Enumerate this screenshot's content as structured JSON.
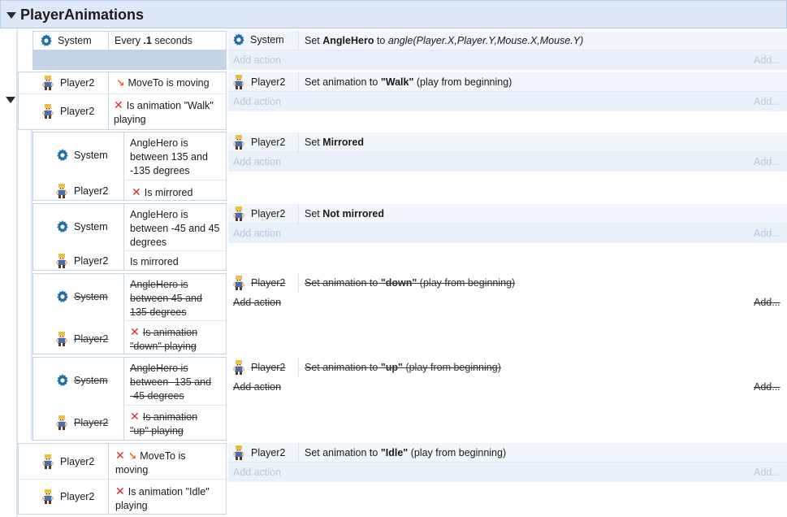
{
  "group": {
    "title": "PlayerAnimations"
  },
  "labels": {
    "system": "System",
    "player2": "Player2",
    "add_action": "Add action",
    "add_more": "Add..."
  },
  "events": [
    {
      "conditions": [
        {
          "object": "System",
          "text": "Every .1 seconds"
        }
      ],
      "actions": [
        {
          "object": "System",
          "text": "Set AngleHero to angle(Player.X,Player.Y,Mouse.X,Mouse.Y)"
        }
      ]
    },
    {
      "conditions": [
        {
          "object": "Player2",
          "text": "MoveTo is moving"
        },
        {
          "object": "Player2",
          "text": "Is animation \"Walk\" playing",
          "inverted": true
        }
      ],
      "actions": [
        {
          "object": "Player2",
          "text": "Set animation to \"Walk\" (play from beginning)"
        }
      ]
    },
    {
      "conditions": [
        {
          "object": "System",
          "text": "AngleHero is between 135 and -135 degrees"
        },
        {
          "object": "Player2",
          "text": "Is mirrored",
          "inverted": true
        }
      ],
      "actions": [
        {
          "object": "Player2",
          "text": "Set Mirrored"
        }
      ]
    },
    {
      "conditions": [
        {
          "object": "System",
          "text": "AngleHero is between -45 and 45 degrees"
        },
        {
          "object": "Player2",
          "text": "Is mirrored"
        }
      ],
      "actions": [
        {
          "object": "Player2",
          "text": "Set Not mirrored"
        }
      ]
    },
    {
      "disabled": true,
      "conditions": [
        {
          "object": "System",
          "text": "AngleHero is between 45 and 135 degrees"
        },
        {
          "object": "Player2",
          "text": "Is animation \"down\" playing",
          "inverted": true
        }
      ],
      "actions": [
        {
          "object": "Player2",
          "text": "Set animation to \"down\" (play from beginning)"
        }
      ]
    },
    {
      "disabled": true,
      "conditions": [
        {
          "object": "System",
          "text": "AngleHero is between -135 and -45 degrees"
        },
        {
          "object": "Player2",
          "text": "Is animation \"up\" playing",
          "inverted": true
        }
      ],
      "actions": [
        {
          "object": "Player2",
          "text": "Set animation to \"up\" (play from beginning)"
        }
      ]
    },
    {
      "conditions": [
        {
          "object": "Player2",
          "text": "MoveTo is moving",
          "inverted": true
        },
        {
          "object": "Player2",
          "text": "Is animation \"Idle\" playing",
          "inverted": true
        }
      ],
      "actions": [
        {
          "object": "Player2",
          "text": "Set animation to \"Idle\" (play from beginning)"
        }
      ]
    }
  ],
  "text_parts": {
    "e1_every": "Every",
    "e1_num": ".1",
    "e1_sec": "seconds",
    "e1_set": "Set",
    "e1_var": "AngleHero",
    "e1_to": "to",
    "e1_expr": "angle(Player.X,Player.Y,Mouse.X,Mouse.Y)",
    "e2_c1": "MoveTo is moving",
    "e2_c2a": "Is animation \"Walk\"",
    "e2_c2b": "playing",
    "e2_set": "Set animation to",
    "e2_anim": "\"Walk\"",
    "e2_tail": "(play from beginning)",
    "e3_c1a": "AngleHero is",
    "e3_c1b": "between 135 and",
    "e3_c1c": "-135 degrees",
    "e3_c2": "Is mirrored",
    "e3_set": "Set",
    "e3_val": "Mirrored",
    "e4_c1a": "AngleHero is",
    "e4_c1b": "between -45 and 45",
    "e4_c1c": "degrees",
    "e4_c2": "Is mirrored",
    "e4_set": "Set",
    "e4_val": "Not mirrored",
    "e5_c1a": "AngleHero is",
    "e5_c1b": "between 45 and",
    "e5_c1c": "135 degrees",
    "e5_c2a": "Is animation",
    "e5_c2b": "\"down\" playing",
    "e5_set": "Set animation to",
    "e5_anim": "\"down\"",
    "e5_tail": "(play from beginning)",
    "e6_c1a": "AngleHero is",
    "e6_c1b": "between -135 and",
    "e6_c1c": "-45 degrees",
    "e6_c2a": "Is animation",
    "e6_c2b": "\"up\" playing",
    "e6_set": "Set animation to",
    "e6_anim": "\"up\"",
    "e6_tail": "(play from beginning)",
    "e7_c1a": "MoveTo is",
    "e7_c1b": "moving",
    "e7_c2a": "Is animation \"Idle\"",
    "e7_c2b": "playing",
    "e7_set": "Set animation to",
    "e7_anim": "\"Idle\"",
    "e7_tail": "(play from beginning)"
  },
  "colors": {
    "header_bg": "#dde8f6",
    "action_bg": "#f1f6fc",
    "add_bg": "#e8f0fa",
    "invert_red": "#e0242c"
  }
}
